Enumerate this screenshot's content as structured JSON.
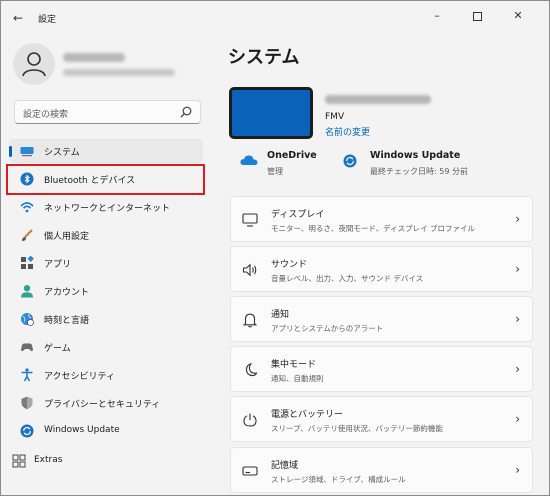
{
  "window": {
    "title": "設定"
  },
  "sidebar": {
    "search_placeholder": "設定の検索",
    "items": [
      {
        "label": "システム",
        "icon": "system-display-icon"
      },
      {
        "label": "Bluetooth とデバイス",
        "icon": "bluetooth-icon"
      },
      {
        "label": "ネットワークとインターネット",
        "icon": "wifi-icon"
      },
      {
        "label": "個人用設定",
        "icon": "brush-icon"
      },
      {
        "label": "アプリ",
        "icon": "apps-icon"
      },
      {
        "label": "アカウント",
        "icon": "account-icon"
      },
      {
        "label": "時刻と言語",
        "icon": "globe-clock-icon"
      },
      {
        "label": "ゲーム",
        "icon": "gamepad-icon"
      },
      {
        "label": "アクセシビリティ",
        "icon": "accessibility-icon"
      },
      {
        "label": "プライバシーとセキュリティ",
        "icon": "shield-icon"
      },
      {
        "label": "Windows Update",
        "icon": "windows-update-icon"
      },
      {
        "label": "Extras",
        "icon": "extras-grid-icon"
      }
    ],
    "active_index": 0,
    "highlighted_index": 1
  },
  "main": {
    "title": "システム",
    "device": {
      "model": "FMV",
      "rename_link": "名前の変更"
    },
    "quick": [
      {
        "title": "OneDrive",
        "sub": "管理",
        "icon": "onedrive-cloud-icon"
      },
      {
        "title": "Windows Update",
        "sub": "最終チェック日時: 59 分前",
        "icon": "windows-update-icon"
      }
    ],
    "cards": [
      {
        "title": "ディスプレイ",
        "sub": "モニター、明るさ、夜間モード、ディスプレイ プロファイル",
        "icon": "monitor-icon"
      },
      {
        "title": "サウンド",
        "sub": "音量レベル、出力、入力、サウンド デバイス",
        "icon": "speaker-icon"
      },
      {
        "title": "通知",
        "sub": "アプリとシステムからのアラート",
        "icon": "bell-icon"
      },
      {
        "title": "集中モード",
        "sub": "通知、自動規則",
        "icon": "moon-icon"
      },
      {
        "title": "電源とバッテリー",
        "sub": "スリープ、バッテリ使用状況、バッテリー節約機能",
        "icon": "power-icon"
      },
      {
        "title": "記憶域",
        "sub": "ストレージ領域、ドライブ、構成ルール",
        "icon": "storage-drive-icon"
      }
    ]
  },
  "colors": {
    "accent": "#0067c0",
    "highlight_border": "#d81e1e",
    "window_bg": "#f3f3f3",
    "card_bg": "#fbfbfb"
  }
}
